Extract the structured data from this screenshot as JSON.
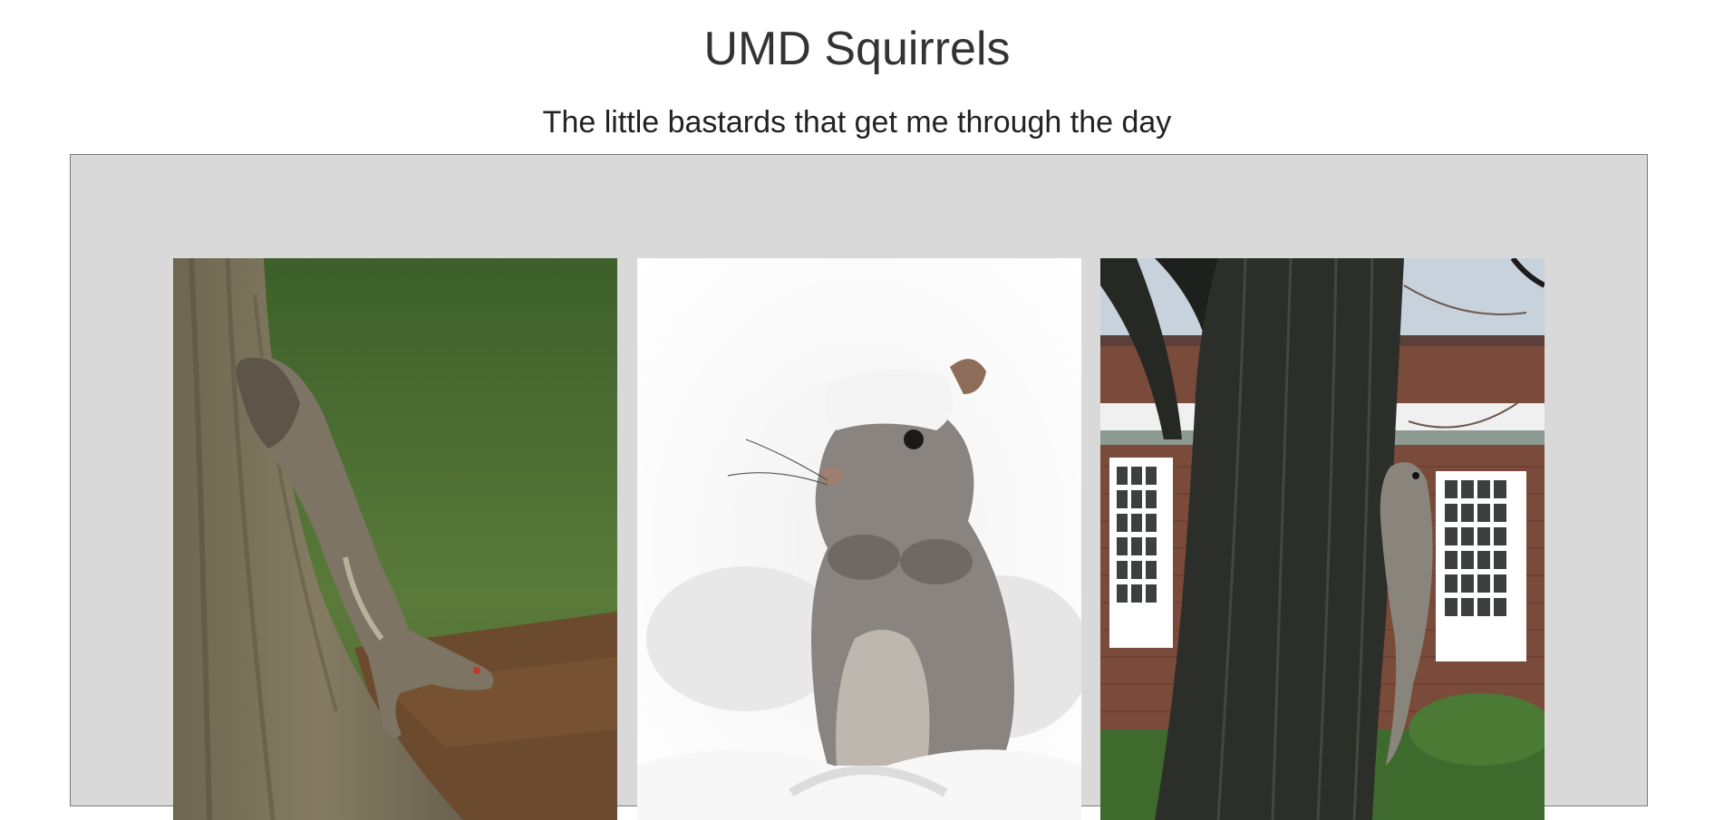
{
  "header": {
    "title": "UMD Squirrels",
    "subtitle": "The little bastards that get me through the day"
  },
  "gallery": {
    "photos": [
      {
        "subject": "squirrel-climbing-down-tree-on-grass"
      },
      {
        "subject": "squirrel-in-snow"
      },
      {
        "subject": "squirrel-on-tree-trunk-by-brick-building"
      }
    ]
  },
  "colors": {
    "panel_background": "#d9d9d9",
    "panel_border": "#7a7a7a",
    "text": "#333333"
  }
}
